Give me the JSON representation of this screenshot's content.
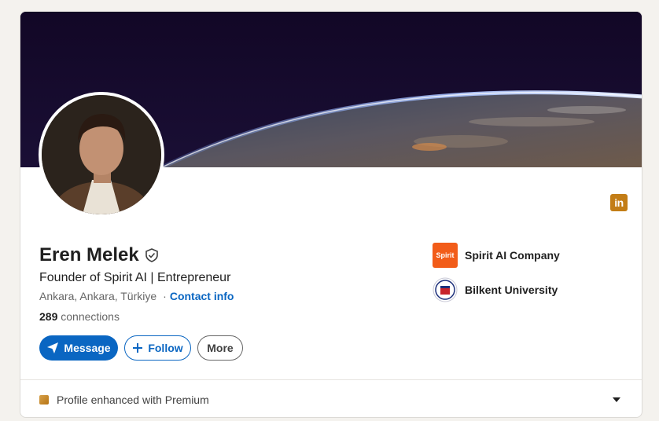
{
  "profile": {
    "name": "Eren Melek",
    "headline": "Founder of Spirit AI | Entrepreneur",
    "location": "Ankara, Ankara, Türkiye",
    "separator": "·",
    "contact_info_label": "Contact info",
    "connections_count": "289",
    "connections_label": "connections"
  },
  "icons": {
    "verified": "shield-check-icon",
    "linkedin": "linkedin-icon",
    "message": "send-icon",
    "follow": "plus-icon",
    "premium": "premium-icon",
    "expand": "caret-down-icon"
  },
  "actions": {
    "message_label": "Message",
    "follow_label": "Follow",
    "more_label": "More"
  },
  "linkedin_badge": {
    "label": "in"
  },
  "organizations": [
    {
      "name": "Spirit AI Company",
      "logo_text": "Spirit"
    },
    {
      "name": "Bilkent University"
    }
  ],
  "premium": {
    "label": "Profile enhanced with Premium"
  },
  "colors": {
    "primary": "#0a66c2",
    "premium_gold": "#c37d16",
    "spirit_orange": "#f25c19"
  }
}
